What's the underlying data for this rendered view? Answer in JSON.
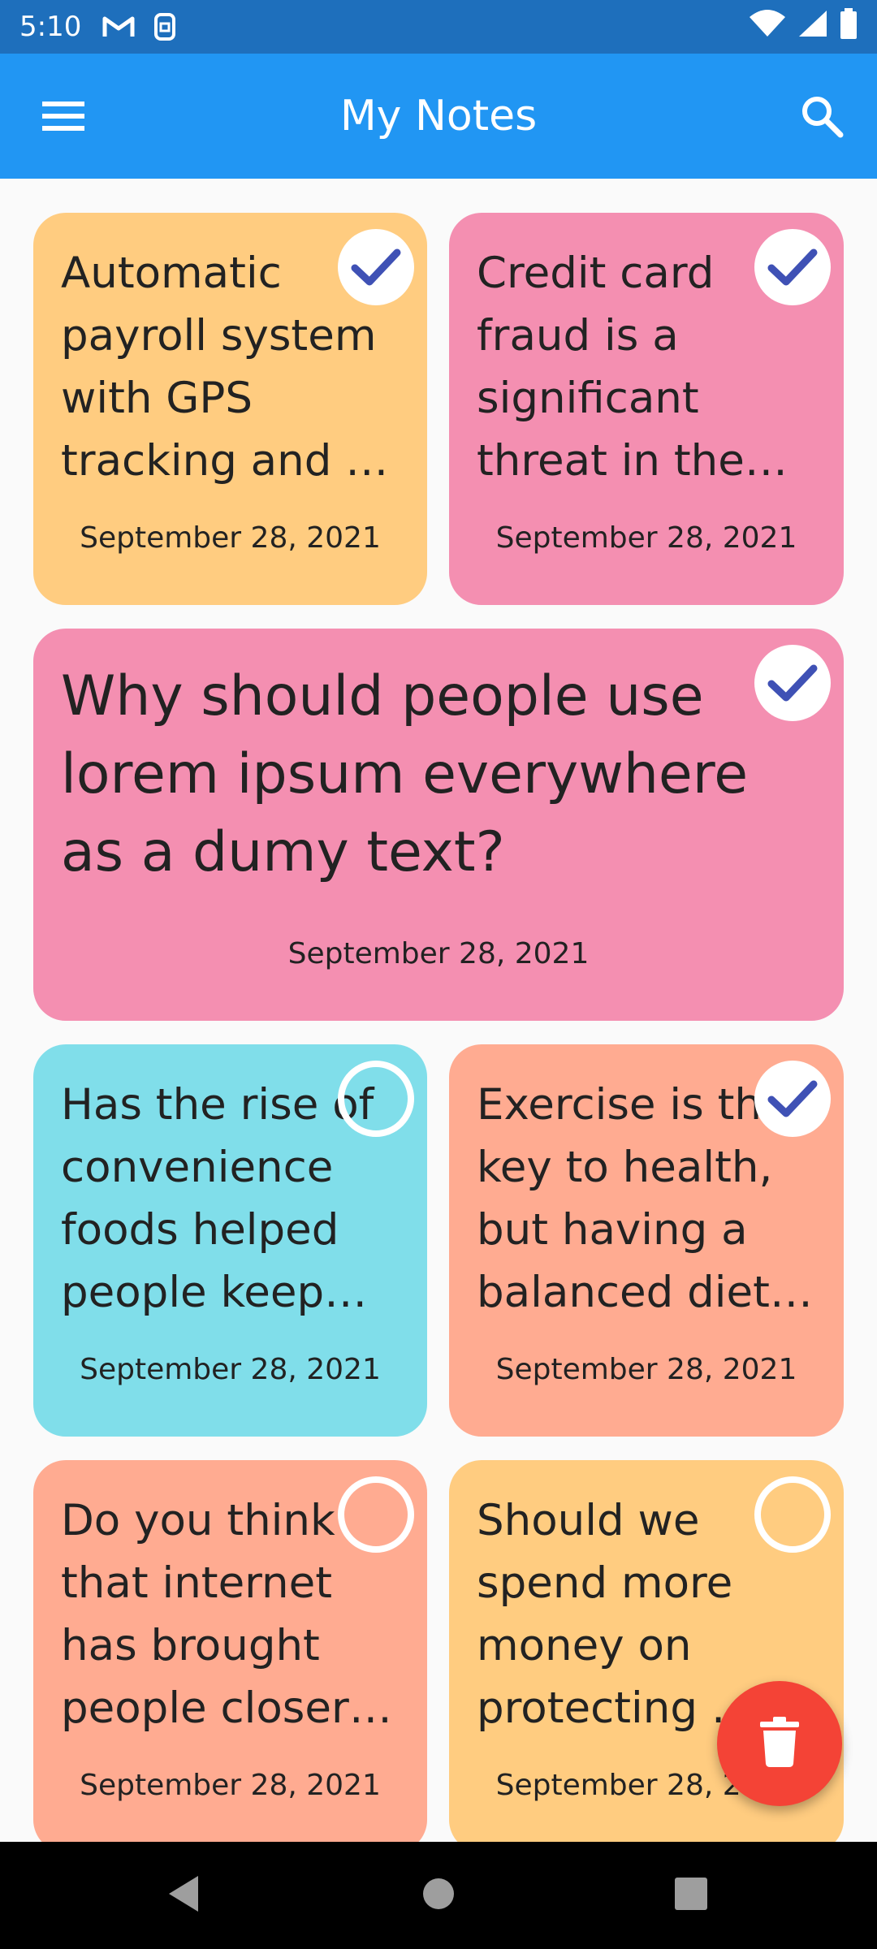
{
  "status_bar": {
    "time": "5:10",
    "icons": [
      "gmail-icon",
      "sim-icon",
      "wifi-icon",
      "signal-icon",
      "battery-icon"
    ]
  },
  "app_bar": {
    "title": "My Notes",
    "menu_icon": "menu-icon",
    "search_icon": "search-icon"
  },
  "notes": [
    {
      "text": "Automatic payroll system with GPS tracking and …",
      "date": "September 28, 2021",
      "checked": true,
      "color": "#ffcc80"
    },
    {
      "text": "Credit card fraud is a significant threat in the FBSI section.",
      "date": "September 28, 2021",
      "checked": true,
      "color": "#f48fb1"
    },
    {
      "text": "Why should people use lorem ipsum everywhere as a dumy text?",
      "date": "September 28, 2021",
      "checked": true,
      "color": "#f48fb1"
    },
    {
      "text": "Has the rise of convenience foods helped people keep up…",
      "date": "September 28, 2021",
      "checked": false,
      "color": "#80deea"
    },
    {
      "text": "Exercise is the key to health, but having a balanced diet i…",
      "date": "September 28, 2021",
      "checked": true,
      "color": "#ffab91"
    },
    {
      "text": "Do you think that internet has brought people closer together…",
      "date": "September 28, 2021",
      "checked": false,
      "color": "#ffab91"
    },
    {
      "text": "Should we spend more money on protecting …",
      "date": "September 28, 2021",
      "checked": false,
      "color": "#ffcc80"
    }
  ],
  "fab": {
    "icon": "delete-icon",
    "color": "#f44336"
  },
  "nav_bar": {
    "icons": [
      "back-icon",
      "home-icon",
      "recents-icon"
    ]
  }
}
